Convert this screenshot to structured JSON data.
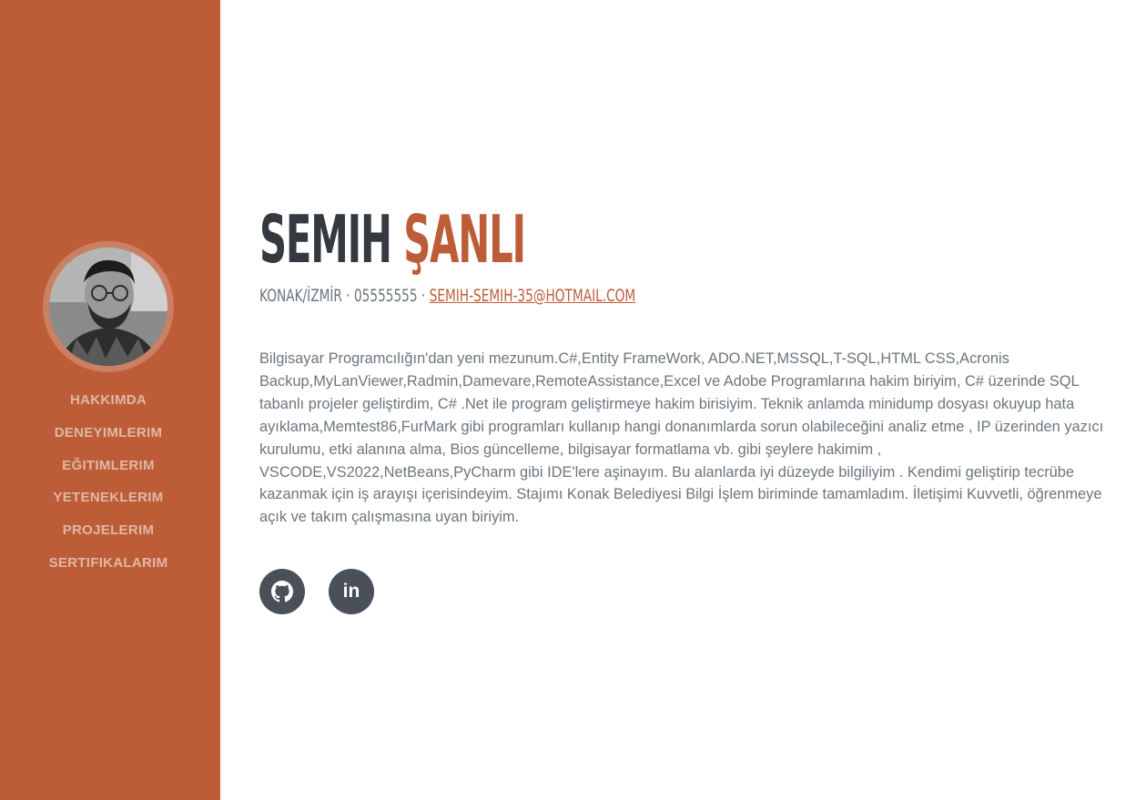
{
  "sidebar": {
    "background_color": "#bd5d38",
    "avatar": "profile-photo",
    "nav_items": [
      {
        "label": "HAKKIMDA"
      },
      {
        "label": "DENEYIMLERIM"
      },
      {
        "label": "EĞITIMLERIM"
      },
      {
        "label": "YETENEKLERIM"
      },
      {
        "label": "PROJELERIM"
      },
      {
        "label": "SERTIFIKALARIM"
      }
    ]
  },
  "about": {
    "first_name": "SEMIH",
    "last_name": "ŞANLI",
    "location_phone": "KONAK/İZMİR · 05555555 · ",
    "email": "SEMIH-SEMIH-35@HOTMAIL.COM",
    "description": "Bilgisayar Programcılığın'dan yeni mezunum.C#,Entity FrameWork, ADO.NET,MSSQL,T-SQL,HTML CSS,Acronis Backup,MyLanViewer,Radmin,Damevare,RemoteAssistance,Excel ve Adobe Programlarına hakim biriyim, C# üzerinde SQL tabanlı projeler geliştirdim, C# .Net ile program geliştirmeye hakim birisiyim. Teknik anlamda minidump dosyası okuyup hata ayıklama,Memtest86,FurMark gibi programları kullanıp hangi donanımlarda sorun olabileceğini analiz etme , IP üzerinden yazıcı kurulumu, etki alanına alma, Bios güncelleme, bilgisayar formatlama vb. gibi şeylere hakimim , VSCODE,VS2022,NetBeans,PyCharm gibi IDE'lere aşinayım. Bu alanlarda iyi düzeyde bilgiliyim . Kendimi geliştirip tecrübe kazanmak için iş arayışı içerisindeyim. Stajımı Konak Belediyesi Bilgi İşlem biriminde tamamladım. İletişimi Kuvvetli, öğrenmeye açık ve takım çalışmasına uyan biriyim.",
    "social": [
      {
        "icon": "github-icon"
      },
      {
        "icon": "linkedin-icon",
        "text": "in"
      }
    ]
  },
  "colors": {
    "accent": "#bd5d38",
    "heading": "#343a40",
    "text": "#6c757d",
    "social_bg": "#495057"
  }
}
